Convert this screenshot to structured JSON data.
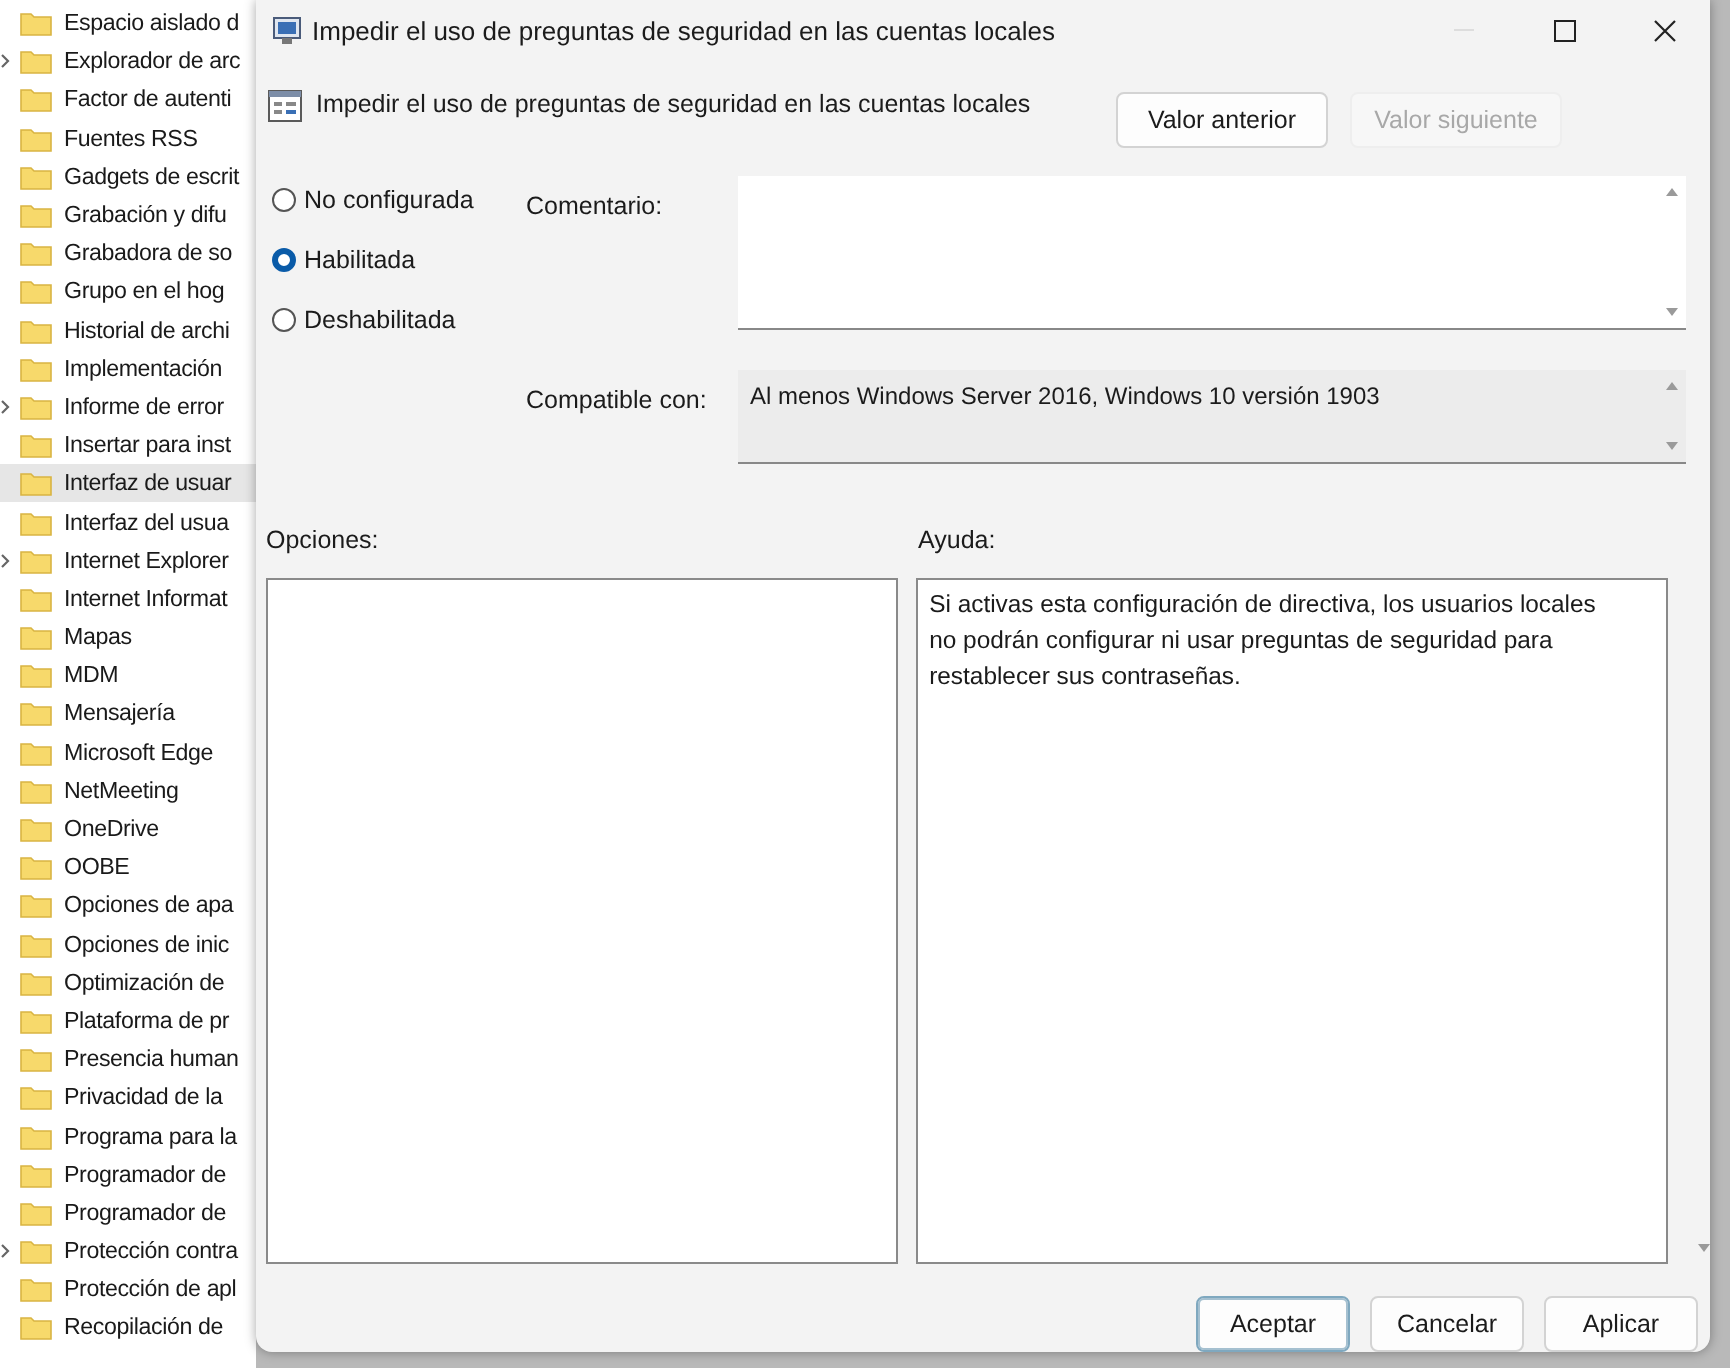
{
  "tree": {
    "items": [
      {
        "label": "Espacio aislado d",
        "expandable": false,
        "selected": false
      },
      {
        "label": "Explorador de arc",
        "expandable": true,
        "selected": false
      },
      {
        "label": "Factor de autenti",
        "expandable": false,
        "selected": false
      },
      {
        "label": "Fuentes RSS",
        "expandable": false,
        "selected": false
      },
      {
        "label": "Gadgets de escrit",
        "expandable": false,
        "selected": false
      },
      {
        "label": "Grabación y difu",
        "expandable": false,
        "selected": false
      },
      {
        "label": "Grabadora de so",
        "expandable": false,
        "selected": false
      },
      {
        "label": "Grupo en el hog",
        "expandable": false,
        "selected": false
      },
      {
        "label": "Historial de archi",
        "expandable": false,
        "selected": false
      },
      {
        "label": "Implementación",
        "expandable": false,
        "selected": false
      },
      {
        "label": "Informe de error",
        "expandable": true,
        "selected": false
      },
      {
        "label": "Insertar para inst",
        "expandable": false,
        "selected": false
      },
      {
        "label": "Interfaz de usuar",
        "expandable": false,
        "selected": true
      },
      {
        "label": "Interfaz del usua",
        "expandable": false,
        "selected": false
      },
      {
        "label": "Internet Explorer",
        "expandable": true,
        "selected": false
      },
      {
        "label": "Internet Informat",
        "expandable": false,
        "selected": false
      },
      {
        "label": "Mapas",
        "expandable": false,
        "selected": false
      },
      {
        "label": "MDM",
        "expandable": false,
        "selected": false
      },
      {
        "label": "Mensajería",
        "expandable": false,
        "selected": false
      },
      {
        "label": "Microsoft Edge",
        "expandable": false,
        "selected": false
      },
      {
        "label": "NetMeeting",
        "expandable": false,
        "selected": false
      },
      {
        "label": "OneDrive",
        "expandable": false,
        "selected": false
      },
      {
        "label": "OOBE",
        "expandable": false,
        "selected": false
      },
      {
        "label": "Opciones de apa",
        "expandable": false,
        "selected": false
      },
      {
        "label": "Opciones de inic",
        "expandable": false,
        "selected": false
      },
      {
        "label": "Optimización de",
        "expandable": false,
        "selected": false
      },
      {
        "label": "Plataforma de pr",
        "expandable": false,
        "selected": false
      },
      {
        "label": "Presencia human",
        "expandable": false,
        "selected": false
      },
      {
        "label": "Privacidad de la",
        "expandable": false,
        "selected": false
      },
      {
        "label": "Programa para la",
        "expandable": false,
        "selected": false
      },
      {
        "label": "Programador de",
        "expandable": false,
        "selected": false
      },
      {
        "label": "Programador de",
        "expandable": false,
        "selected": false
      },
      {
        "label": "Protección contra",
        "expandable": true,
        "selected": false
      },
      {
        "label": "Protección de apl",
        "expandable": false,
        "selected": false
      },
      {
        "label": "Recopilación de",
        "expandable": false,
        "selected": false
      }
    ]
  },
  "dialog": {
    "title": "Impedir el uso de preguntas de seguridad en las cuentas locales",
    "setting_name": "Impedir el uso de preguntas de seguridad en las cuentas locales",
    "nav_buttons": [
      {
        "label": "Valor anterior",
        "disabled": false
      },
      {
        "label": "Valor siguiente",
        "disabled": true
      }
    ],
    "states": [
      {
        "label": "No configurada",
        "selected": false
      },
      {
        "label": "Habilitada",
        "selected": true
      },
      {
        "label": "Deshabilitada",
        "selected": false
      }
    ],
    "comment": {
      "label": "Comentario:"
    },
    "compatible": {
      "label": "Compatible con:",
      "value": "Al menos Windows Server 2016, Windows 10 versión 1903"
    },
    "options": {
      "label": "Opciones:"
    },
    "help": {
      "label": "Ayuda:",
      "text": "Si activas esta configuración de directiva, los usuarios locales no podrán configurar ni usar preguntas de seguridad para restablecer sus contraseñas."
    },
    "buttons": [
      {
        "label": "Aceptar",
        "default": true
      },
      {
        "label": "Cancelar",
        "default": false
      },
      {
        "label": "Aplicar",
        "default": false
      }
    ]
  }
}
